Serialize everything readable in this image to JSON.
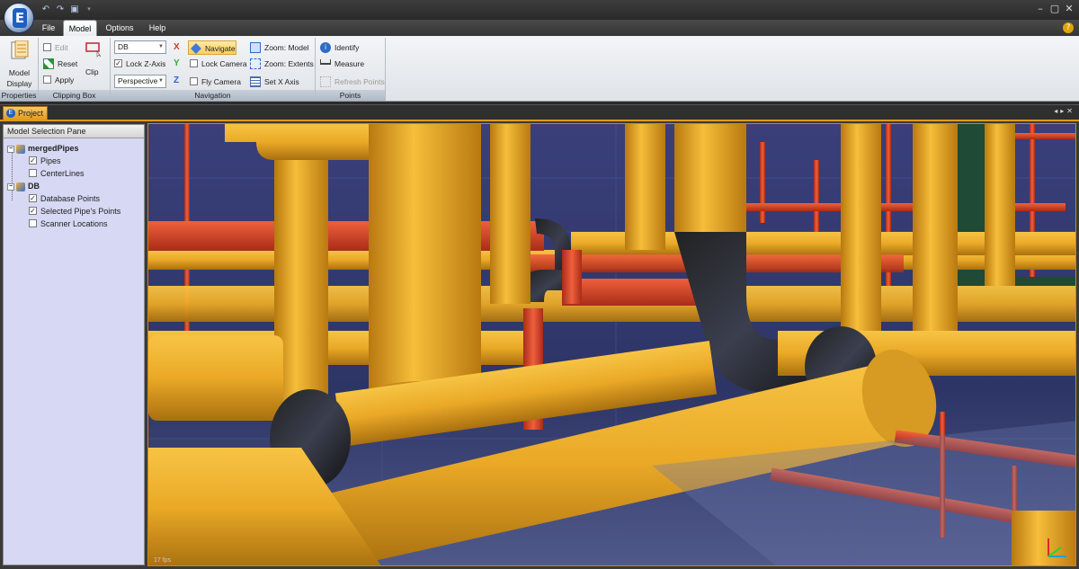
{
  "menu": {
    "tabs": [
      {
        "label": "File"
      },
      {
        "label": "Model",
        "active": true
      },
      {
        "label": "Options"
      },
      {
        "label": "Help"
      }
    ]
  },
  "ribbon": {
    "properties": {
      "button_label_line1": "Model",
      "button_label_line2": "Display",
      "group_label": "Properties"
    },
    "clipping_box": {
      "edit_label": "Edit",
      "reset_label": "Reset",
      "apply_label": "Apply",
      "clip_label": "Clip",
      "group_label": "Clipping Box"
    },
    "navigation": {
      "db_combo_value": "DB",
      "lock_z_axis_label": "Lock Z-Axis",
      "lock_z_axis_checked": true,
      "projection_combo_value": "Perspective",
      "axis_x": "X",
      "axis_y": "Y",
      "axis_z": "Z",
      "navigate_label": "Navigate",
      "lock_camera_label": "Lock Camera",
      "fly_camera_label": "Fly Camera",
      "zoom_model_label": "Zoom: Model",
      "zoom_extents_label": "Zoom: Extents",
      "set_x_axis_label": "Set X Axis",
      "group_label": "Navigation"
    },
    "points": {
      "identify_label": "Identify",
      "measure_label": "Measure",
      "refresh_points_label": "Refresh Points",
      "group_label": "Points"
    }
  },
  "project_tab": {
    "label": "Project"
  },
  "side_pane": {
    "title": "Model Selection Pane",
    "tree": [
      {
        "label": "mergedPipes",
        "bold": true
      },
      {
        "label": "Pipes",
        "checked": true
      },
      {
        "label": "CenterLines",
        "checked": false
      },
      {
        "label": "DB",
        "bold": true
      },
      {
        "label": "Database Points",
        "checked": true
      },
      {
        "label": "Selected Pipe's Points",
        "checked": true
      },
      {
        "label": "Scanner Locations",
        "checked": false
      }
    ]
  },
  "viewport": {
    "fps_text": "17 fps"
  },
  "colors": {
    "accent_orange": "#e29a12",
    "pipe_yellow": "#f2b52a",
    "pipe_red": "#d9442a",
    "background_blue": "#2d3566"
  }
}
